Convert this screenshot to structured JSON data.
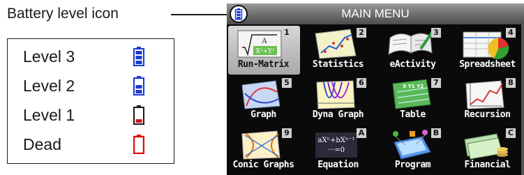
{
  "callout": {
    "label": "Battery level icon"
  },
  "legend": {
    "items": [
      {
        "label": "Level 3",
        "bars": 3,
        "color": "#1a3ad6"
      },
      {
        "label": "Level 2",
        "bars": 2,
        "color": "#1a3ad6"
      },
      {
        "label": "Level 1",
        "bars": 1,
        "color": "#e01010"
      },
      {
        "label": "Dead",
        "bars": 0,
        "color": "#e01010"
      }
    ]
  },
  "menu": {
    "title": "MAIN MENU",
    "selected": "Run-Matrix",
    "items": [
      {
        "name": "Run-Matrix",
        "key": "1",
        "icon": "run-matrix-icon"
      },
      {
        "name": "Statistics",
        "key": "2",
        "icon": "statistics-icon"
      },
      {
        "name": "eActivity",
        "key": "3",
        "icon": "eactivity-icon"
      },
      {
        "name": "Spreadsheet",
        "key": "4",
        "icon": "spreadsheet-icon"
      },
      {
        "name": "Graph",
        "key": "5",
        "icon": "graph-icon"
      },
      {
        "name": "Dyna Graph",
        "key": "6",
        "icon": "dyna-graph-icon"
      },
      {
        "name": "Table",
        "key": "7",
        "icon": "table-icon"
      },
      {
        "name": "Recursion",
        "key": "8",
        "icon": "recursion-icon"
      },
      {
        "name": "Conic Graphs",
        "key": "9",
        "icon": "conic-graphs-icon"
      },
      {
        "name": "Equation",
        "key": "A",
        "icon": "equation-icon"
      },
      {
        "name": "Program",
        "key": "B",
        "icon": "program-icon"
      },
      {
        "name": "Financial",
        "key": "C",
        "icon": "financial-icon"
      }
    ]
  }
}
